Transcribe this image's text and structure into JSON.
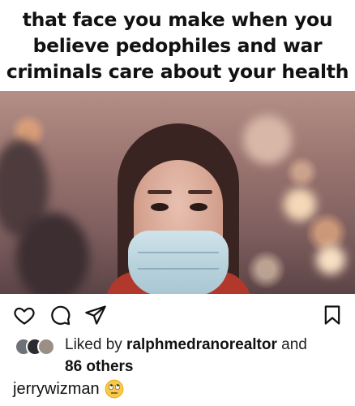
{
  "post": {
    "caption_lines": [
      "that face you make when you",
      "believe pedophiles and war",
      "criminals care about your health"
    ]
  },
  "actions": {
    "like_icon": "heart-icon",
    "comment_icon": "comment-icon",
    "share_icon": "share-icon",
    "save_icon": "bookmark-icon"
  },
  "likes": {
    "prefix": "Liked by ",
    "user": "ralphmedranorealtor",
    "and": " and",
    "others": "86 others"
  },
  "comment": {
    "username": "jerrywizman",
    "emoji_name": "eye-roll-emoji"
  },
  "colors": {
    "text": "#111111",
    "scarf": "#b2382c",
    "mask": "#b9d3dd"
  }
}
